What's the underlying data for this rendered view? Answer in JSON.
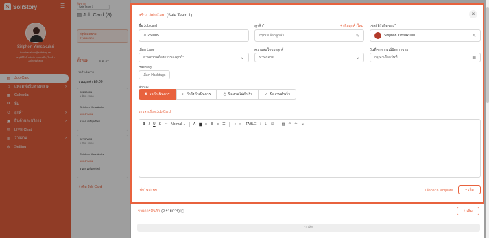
{
  "brand": {
    "name": "SoliStory"
  },
  "user": {
    "name": "Siriphon Yimsakulsri",
    "email": "fuenthanakorn@solistory.net",
    "role": "อนุมัติสิทธิ์ admin ระบบหลัก, ร้านค้า",
    "title": "Administrator"
  },
  "sidebar": {
    "items": [
      {
        "label": "Job Card",
        "icon": "card-icon",
        "active": true
      },
      {
        "label": "แพลตฟอร์มทางตลาด",
        "icon": "cart-icon",
        "chevron": true
      },
      {
        "label": "Calendar",
        "icon": "calendar-icon"
      },
      {
        "label": "ทีม",
        "icon": "team-icon"
      },
      {
        "label": "ลูกค้า",
        "icon": "customer-icon",
        "chevron": true
      },
      {
        "label": "สินค้าและบริการ",
        "icon": "box-icon",
        "chevron": true
      },
      {
        "label": "LIVE Chat",
        "icon": "chat-icon"
      },
      {
        "label": "รายงาน",
        "icon": "report-icon",
        "chevron": true
      },
      {
        "label": "Setting",
        "icon": "gear-icon"
      }
    ]
  },
  "middle": {
    "team_label": "ทีมขาย",
    "team_value": "Sale Team 1",
    "title": "Job Card",
    "count": "(8)",
    "summary_label": "สรุปยอดขาย",
    "summary_sub": "สรุปยอดขาย",
    "tab": "ทั้งหมด",
    "date": "ต.ค. 67",
    "status": "รอดำเนินการ",
    "total": "รวมมูลค่า ฿0.00",
    "card1": {
      "code": "JC250001",
      "date": "1 มิ.ย. 2568",
      "name": "Siriphon Yimsakulsri",
      "tag": "ขายตามนัด",
      "person": "ธนกร เจริญทรัพย์"
    },
    "card2": {
      "code": "JC250003",
      "date": "1 มิ.ย. 2568",
      "name": "Siriphon Yimsakulsri",
      "tag": "ขายตามนัด",
      "person": "ธนกร เจริญทรัพย์"
    },
    "add_label": "+ เพิ่ม Job Card"
  },
  "modal": {
    "title": "สร้าง Job Card",
    "team": "(Sale Team 1)",
    "job_card_name_label": "ชื่อ Job card",
    "job_card_name_value": "JC250005",
    "customer_label": "ลูกค้า*",
    "customer_add_link": "+ เพิ่มลูกค้าใหม่",
    "customer_placeholder": "กรุณาเลือกลูกค้า",
    "owner_label": "เซลล์ที่รับผิดชอบ*",
    "owner_value": "Siriphon Yimsakulsri",
    "lane_label": "เลือก Lane",
    "lane_value": "ตามความต้องการของลูกค้า",
    "interest_label": "ความสนใจของลูกค้า",
    "interest_value": "ปานกลาง",
    "due_label": "วันที่คาดการณ์ปิดการขาย",
    "due_placeholder": "กรุณาเลือกวันที่",
    "hashtag_label": "Hashtag",
    "hashtag_button": "เลือก Hashtags",
    "status_label": "สถานะ",
    "statuses": [
      {
        "label": "รอดำเนินการ",
        "icon": "hourglass-icon",
        "active": true
      },
      {
        "label": "กำลังดำเนินการ",
        "icon": "progress-icon"
      },
      {
        "label": "ปิดงานไม่สำเร็จ",
        "icon": "clock-icon"
      },
      {
        "label": "ปิดงานสำเร็จ",
        "icon": "check-icon"
      }
    ],
    "detail_label": "รายละเอียด Job Card",
    "toolbar": {
      "bold": "B",
      "italic": "I",
      "underline": "U",
      "strike": "S",
      "style": "Normal",
      "table": "TABLE"
    },
    "attach_link": "เพิ่มไฟล์แนบ",
    "template_link": "เลือกจาก template",
    "add_button": "+ เพิ่ม"
  },
  "products": {
    "label": "รายการสินค้า",
    "count": "(0 รายการ)",
    "add_button": "+ เพิ่ม"
  },
  "save_button": "บันทึก"
}
